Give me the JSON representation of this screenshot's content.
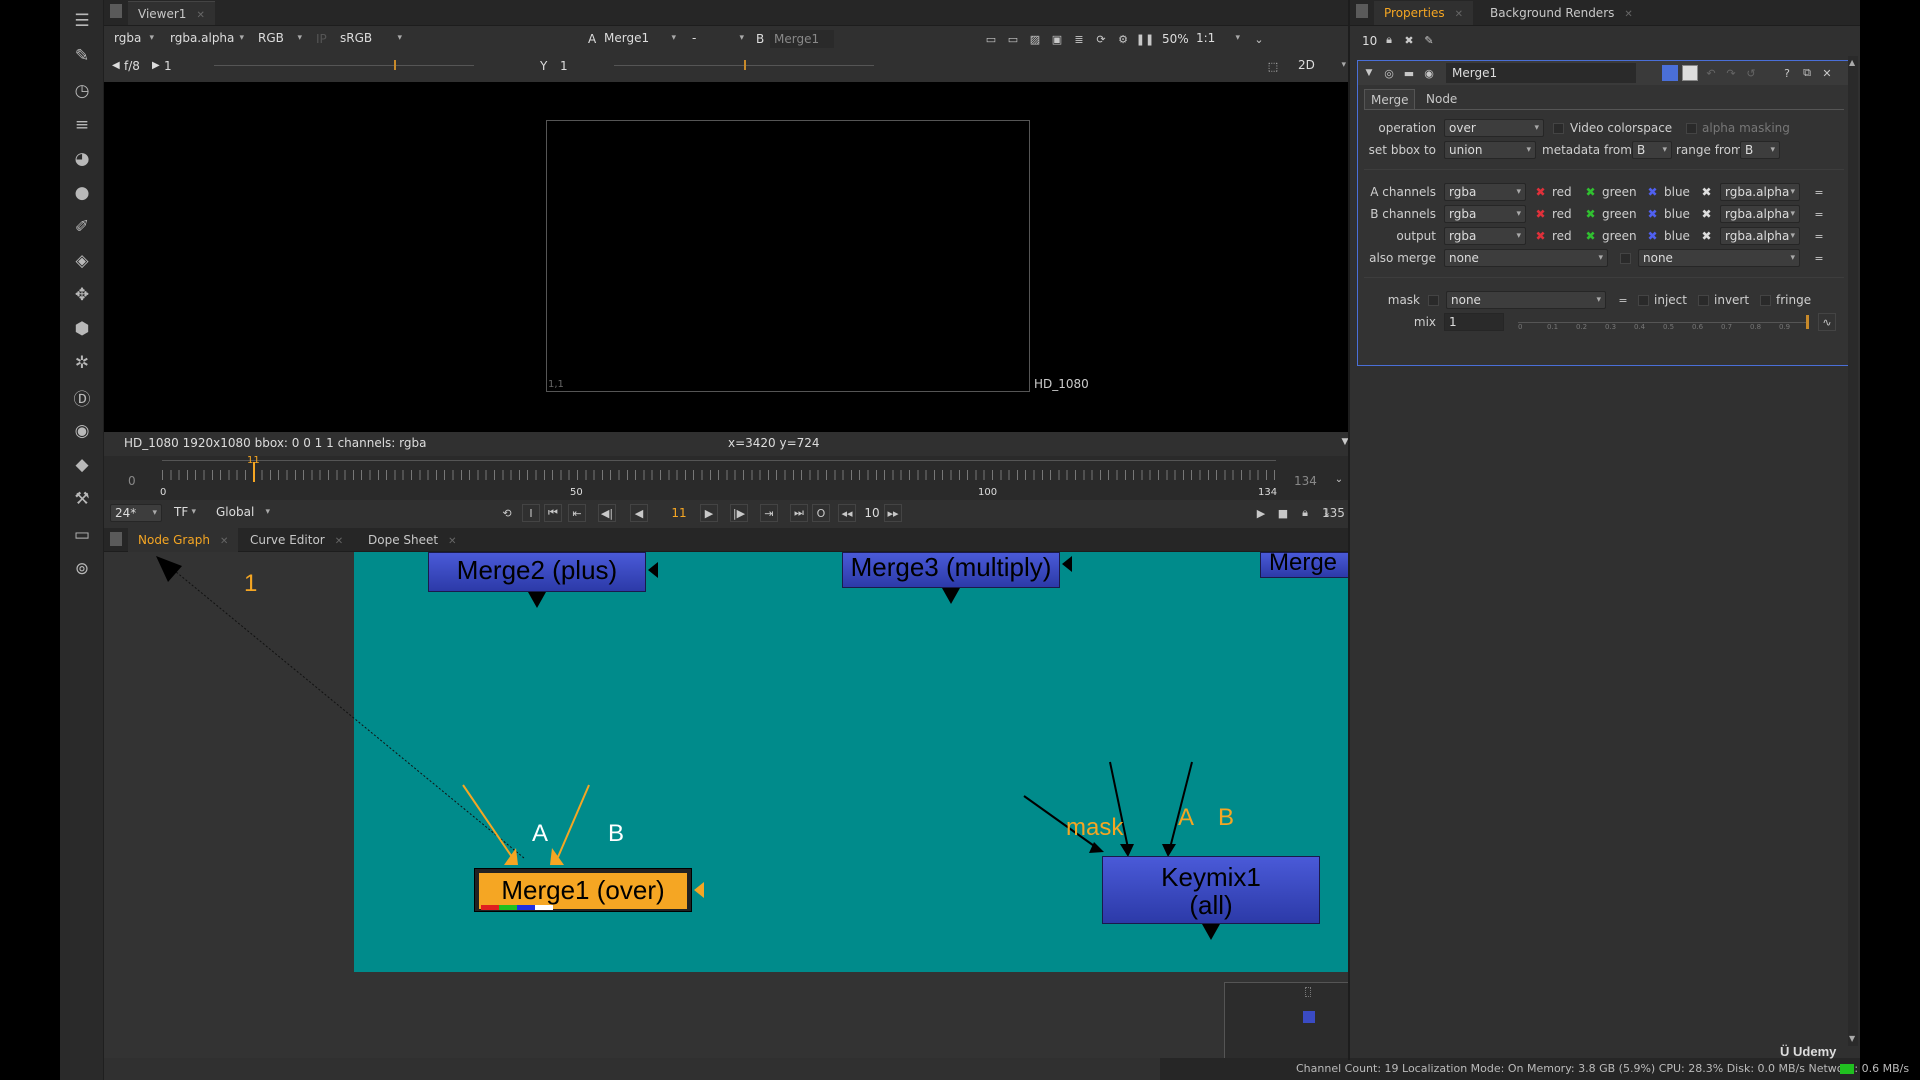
{
  "viewer": {
    "tab": "Viewer1",
    "channels": "rgba",
    "alpha": "rgba.alpha",
    "display": "RGB",
    "ip": "IP",
    "lut": "sRGB",
    "a_label": "A",
    "a_input": "Merge1",
    "wipe": "-",
    "b_label": "B",
    "b_input": "Merge1",
    "zoom": "50%",
    "ratio": "1:1",
    "gain_label": "f/8",
    "gain_value": "1",
    "gamma_label": "Y",
    "gamma_value": "1",
    "view_mode": "2D",
    "format_label": "HD_1080",
    "origin_label": "1,1",
    "info_left": "HD_1080 1920x1080  bbox: 0 0 1 1 channels: rgba",
    "info_center": "x=3420 y=724"
  },
  "timeline": {
    "start": "0",
    "end": "134",
    "tick_0": "0",
    "tick_50": "50",
    "tick_100": "100",
    "tick_134": "134",
    "fps": "24*",
    "tf": "TF",
    "global": "Global",
    "in_mark": "I",
    "out_mark": "O",
    "current_frame": "11",
    "increment": "10",
    "last_frame": "135",
    "playhead_label": "11"
  },
  "graph_tabs": [
    "Node Graph",
    "Curve Editor",
    "Dope Sheet"
  ],
  "graph": {
    "backdrop_color": "#008b8b",
    "nodes": {
      "merge2": "Merge2 (plus)",
      "merge3": "Merge3 (multiply)",
      "merge_partial": "Merge",
      "merge1": "Merge1 (over)",
      "keymix_line1": "Keymix1",
      "keymix_line2": "(all)"
    },
    "labels": {
      "one": "1",
      "a1": "A",
      "b1": "B",
      "mask": "mask",
      "a2": "A",
      "b2": "B"
    }
  },
  "properties": {
    "tab": "Properties",
    "tab2": "Background Renders",
    "max_panels": "10",
    "node_name": "Merge1",
    "tabs": [
      "Merge",
      "Node"
    ],
    "operation_label": "operation",
    "operation_value": "over",
    "video_colorspace": "Video colorspace",
    "alpha_masking": "alpha masking",
    "bbox_label": "set bbox to",
    "bbox_value": "union",
    "metadata_label": "metadata from",
    "metadata_value": "B",
    "range_label": "range from",
    "range_value": "B",
    "channel_rows": [
      {
        "label": "A channels",
        "value": "rgba",
        "r": "red",
        "g": "green",
        "b": "blue",
        "a": "rgba.alpha"
      },
      {
        "label": "B channels",
        "value": "rgba",
        "r": "red",
        "g": "green",
        "b": "blue",
        "a": "rgba.alpha"
      },
      {
        "label": "output",
        "value": "rgba",
        "r": "red",
        "g": "green",
        "b": "blue",
        "a": "rgba.alpha"
      }
    ],
    "also_merge_label": "also merge",
    "also_merge_value": "none",
    "also_merge_value2": "none",
    "mask_label": "mask",
    "mask_value": "none",
    "inject": "inject",
    "invert": "invert",
    "fringe": "fringe",
    "mix_label": "mix",
    "mix_value": "1",
    "mix_ticks": [
      "0",
      "0.1",
      "0.2",
      "0.3",
      "0.4",
      "0.5",
      "0.6",
      "0.7",
      "0.8",
      "0.9"
    ]
  },
  "status_bar": "Channel Count: 19  Localization Mode: On  Memory: 3.8 GB (5.9%)  CPU: 28.3%  Disk: 0.0 MB/s  Network: 0.6 MB/s",
  "watermark": "Udemy",
  "colors": {
    "accent_orange": "#f5a623",
    "node_blue": "#3a4bc4",
    "merge1_orange": "#f5a623",
    "panel_select": "#4a6fd8"
  }
}
